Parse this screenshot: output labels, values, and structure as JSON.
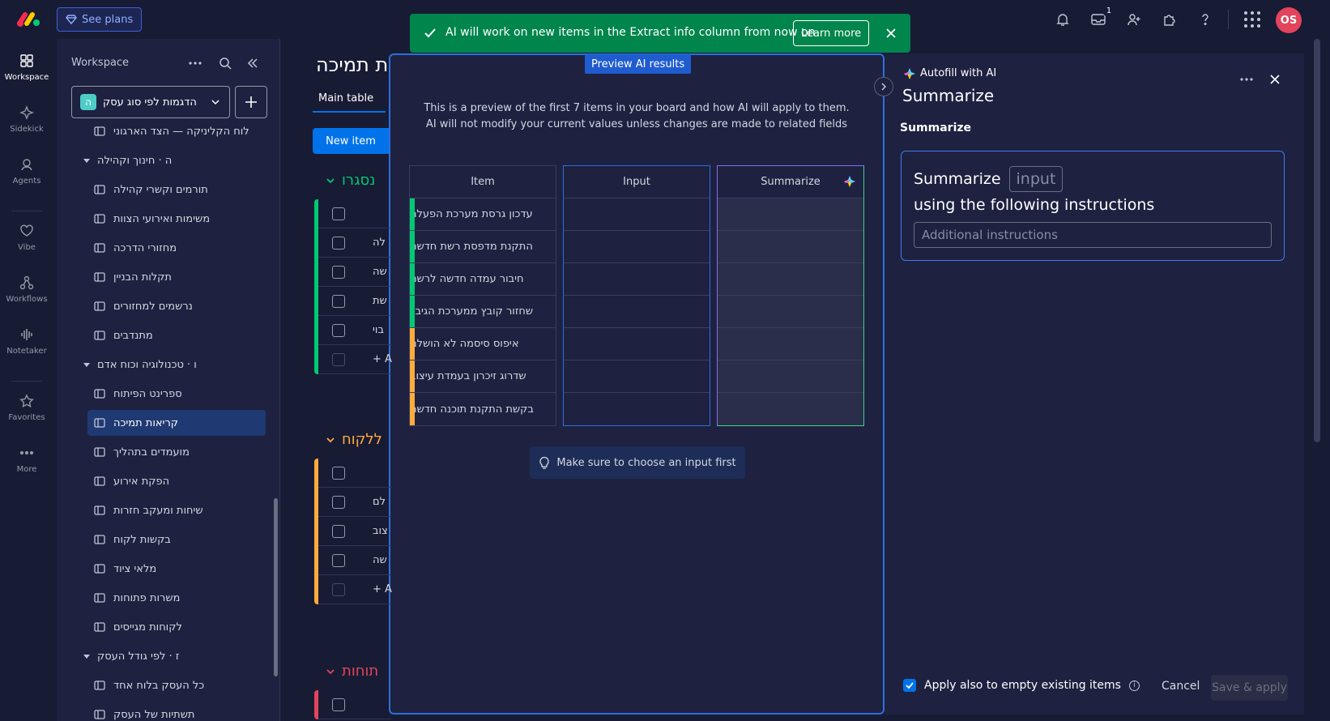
{
  "topbar": {
    "see_plans": "See plans",
    "inbox_badge": "1",
    "avatar_initials": "OS"
  },
  "rail": {
    "items": [
      {
        "label": "Workspace",
        "icon": "grid-icon"
      },
      {
        "label": "Sidekick",
        "icon": "sparkle-icon"
      },
      {
        "label": "Agents",
        "icon": "agent-icon"
      },
      {
        "label": "Vibe",
        "icon": "heart-icon"
      },
      {
        "label": "Workflows",
        "icon": "workflow-icon"
      },
      {
        "label": "Notetaker",
        "icon": "waveform-icon"
      },
      {
        "label": "Favorites",
        "icon": "star-icon"
      },
      {
        "label": "More",
        "icon": "more-icon"
      }
    ]
  },
  "sidebar": {
    "title": "Workspace",
    "workspace_name": "הדגמות לפי סוג עסק",
    "workspace_badge": "ה",
    "items": [
      {
        "type": "board",
        "label": "לוח הקליניקה — הצד הארגוני"
      },
      {
        "type": "folder",
        "label": "ה · חינוך וקהילה"
      },
      {
        "type": "board",
        "label": "תורמים וקשרי קהילה"
      },
      {
        "type": "board",
        "label": "משימות ואירועי הצוות"
      },
      {
        "type": "board",
        "label": "מחזורי הדרכה"
      },
      {
        "type": "board",
        "label": "תקלות הבניין"
      },
      {
        "type": "board",
        "label": "נרשמים למחזורים"
      },
      {
        "type": "board",
        "label": "מתנדבים"
      },
      {
        "type": "folder",
        "label": "ו · טכנולוגיה וכוח אדם"
      },
      {
        "type": "board",
        "label": "ספרינט הפיתוח"
      },
      {
        "type": "board",
        "label": "קריאות תמיכה",
        "active": true
      },
      {
        "type": "board",
        "label": "מועמדים בתהליך"
      },
      {
        "type": "board",
        "label": "הפקת אירוע"
      },
      {
        "type": "board",
        "label": "שיחות ומעקב חזרות"
      },
      {
        "type": "board",
        "label": "בקשות לקוח"
      },
      {
        "type": "board",
        "label": "מלאי ציוד"
      },
      {
        "type": "board",
        "label": "משרות פתוחות"
      },
      {
        "type": "board",
        "label": "לקוחות מגייסים"
      },
      {
        "type": "folder",
        "label": "ז · לפי גודל העסק"
      },
      {
        "type": "board",
        "label": "כל העסק בלוח אחד"
      },
      {
        "type": "board",
        "label": "תשתיות של העסק"
      }
    ]
  },
  "board": {
    "title": "ת תמיכה",
    "tab_main": "Main table",
    "new_item": "New item",
    "groups": [
      {
        "title": "נסגרו",
        "color": "#00c875",
        "rows": [
          "לה",
          "שה",
          "שת",
          "בוי"
        ],
        "add": "+ A"
      },
      {
        "title": "ללקוח",
        "color": "#fdab3d",
        "rows": [
          "לם",
          "צוב",
          "שה"
        ],
        "add": "+ A"
      },
      {
        "title": "תוחות",
        "color": "#e2445c",
        "rows": [],
        "add": ""
      }
    ]
  },
  "toast": {
    "message": "AI will work on new items in the Extract info column from now on",
    "learn_more": "Learn more"
  },
  "preview": {
    "label": "Preview AI results",
    "description_line1": "This is a preview of the first 7 items in your board and how AI will apply to them.",
    "description_line2": "AI will not modify your current values unless changes are made to related fields",
    "columns": [
      "Item",
      "Input",
      "Summarize"
    ],
    "items": [
      {
        "text": "עדכון גרסת מערכת הפעלה",
        "color": "#00c875"
      },
      {
        "text": "התקנת מדפסת רשת חדשה",
        "color": "#00c875"
      },
      {
        "text": "חיבור עמדה חדשה לרשת",
        "color": "#00c875"
      },
      {
        "text": "שחזור קובץ ממערכת הגיבוי",
        "color": "#00c875"
      },
      {
        "text": "איפוס סיסמה לא הושלם",
        "color": "#fdab3d"
      },
      {
        "text": "שדרוג זיכרון בעמדת עיצוב",
        "color": "#fdab3d"
      },
      {
        "text": "בקשת התקנת תוכנה חדשה",
        "color": "#fdab3d"
      }
    ],
    "hint": "Make sure to choose an input first"
  },
  "panel": {
    "autofill_label": "Autofill with AI",
    "title": "Summarize",
    "section_title": "Summarize",
    "box_word": "Summarize",
    "input_chip": "input",
    "instructions_line": "using the following instructions",
    "additional_placeholder": "Additional instructions",
    "apply_empty": "Apply also to empty existing items",
    "apply_checked": true,
    "cancel": "Cancel",
    "save_apply": "Save & apply"
  },
  "colors": {
    "accent": "#0073ea",
    "toast_green": "#00854d",
    "done_green": "#00c875",
    "working_orange": "#fdab3d",
    "stuck_red": "#e2445c"
  }
}
